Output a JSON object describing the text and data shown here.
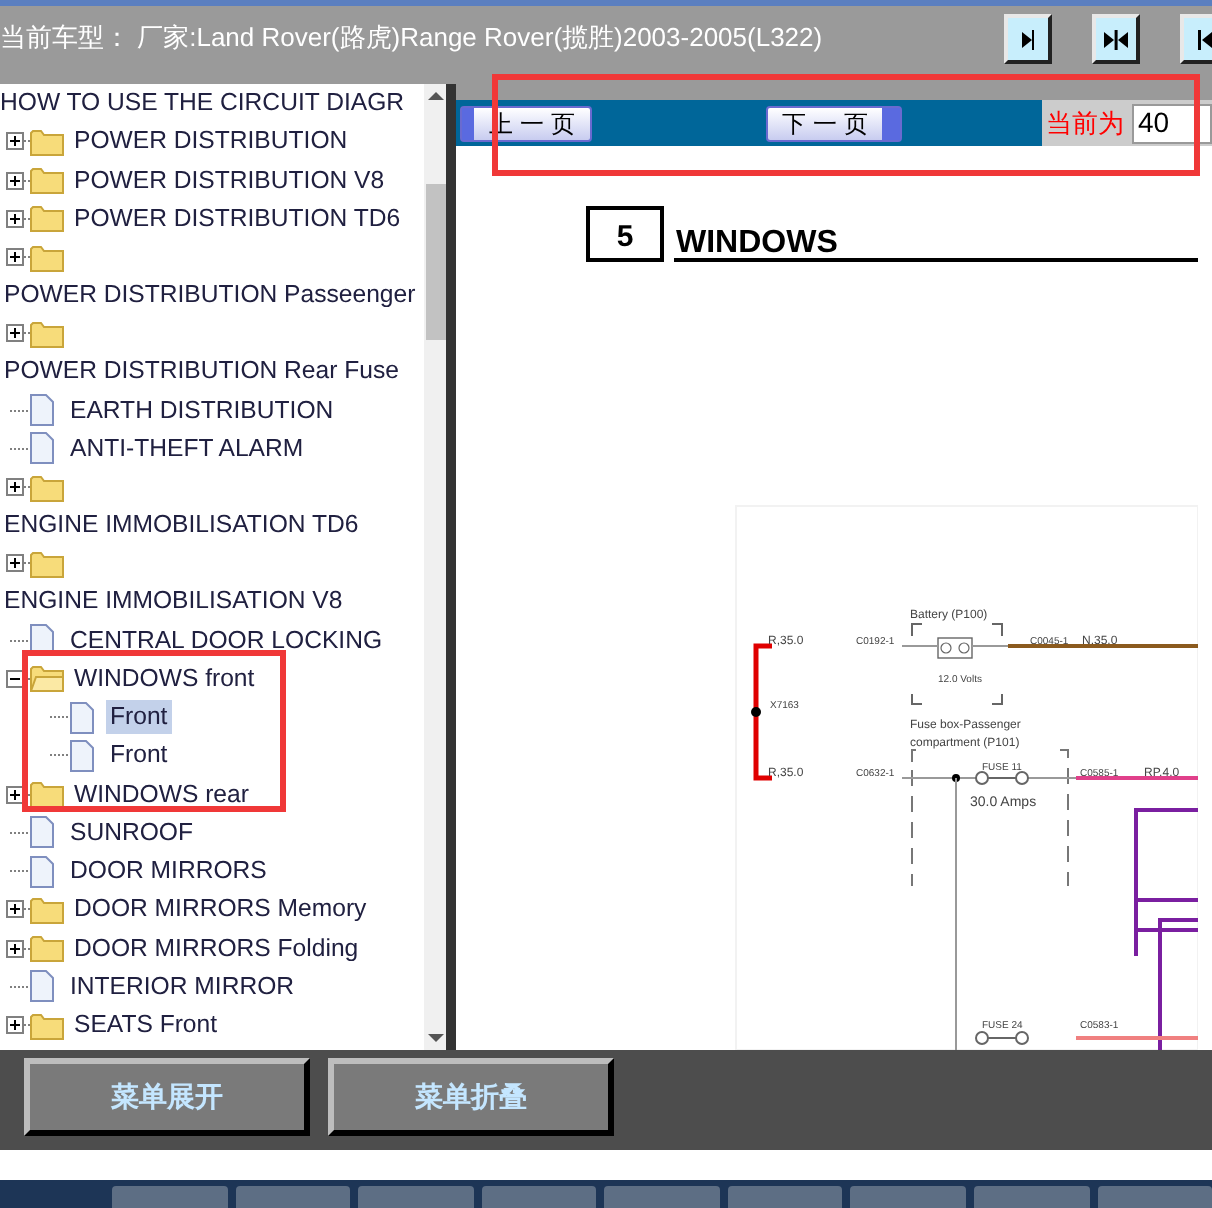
{
  "header": {
    "title": "当前车型：  厂家:Land Rover(路虎)Range Rover(揽胜)2003-2005(L322)",
    "buttons": [
      {
        "kind": "right"
      },
      {
        "kind": "both"
      },
      {
        "kind": "left"
      }
    ]
  },
  "tree": [
    {
      "kind": "fragment",
      "label": "HOW TO USE THE CIRCUIT DIAGR"
    },
    {
      "kind": "folder",
      "label": "POWER DISTRIBUTION",
      "expanded": false,
      "selected": false
    },
    {
      "kind": "folder",
      "label": "POWER DISTRIBUTION V8",
      "expanded": false,
      "selected": false
    },
    {
      "kind": "folder",
      "label": "POWER DISTRIBUTION TD6",
      "expanded": false,
      "selected": false
    },
    {
      "kind": "folder",
      "label": "POWER DISTRIBUTION Passeenger",
      "expanded": false,
      "selected": false
    },
    {
      "kind": "folder",
      "label": "POWER DISTRIBUTION Rear Fuse",
      "expanded": false,
      "selected": false
    },
    {
      "kind": "doc",
      "label": "EARTH DISTRIBUTION",
      "selected": false
    },
    {
      "kind": "doc",
      "label": "ANTI-THEFT ALARM",
      "selected": false
    },
    {
      "kind": "folder",
      "label": "ENGINE IMMOBILISATION TD6",
      "expanded": false,
      "selected": false
    },
    {
      "kind": "folder",
      "label": "ENGINE IMMOBILISATION V8",
      "expanded": false,
      "selected": false
    },
    {
      "kind": "doc",
      "label": "CENTRAL DOOR LOCKING",
      "selected": false
    },
    {
      "kind": "folder",
      "label": "WINDOWS front",
      "expanded": true,
      "selected": false,
      "children": [
        {
          "kind": "doc",
          "label": "Front",
          "selected": true
        },
        {
          "kind": "doc",
          "label": "Front",
          "selected": false
        }
      ]
    },
    {
      "kind": "folder",
      "label": "WINDOWS rear",
      "expanded": false,
      "selected": false
    },
    {
      "kind": "doc",
      "label": "SUNROOF",
      "selected": false
    },
    {
      "kind": "doc",
      "label": "DOOR MIRRORS",
      "selected": false
    },
    {
      "kind": "folder",
      "label": "DOOR MIRRORS Memory",
      "expanded": false,
      "selected": false
    },
    {
      "kind": "folder",
      "label": "DOOR MIRRORS Folding",
      "expanded": false,
      "selected": false
    },
    {
      "kind": "doc",
      "label": "INTERIOR MIRROR",
      "selected": false
    },
    {
      "kind": "folder",
      "label": "SEATS Front",
      "expanded": false,
      "selected": false
    }
  ],
  "pager": {
    "prev": "上 一 页",
    "next": "下 一 页",
    "current_label": "当前为",
    "current_value": "40"
  },
  "document": {
    "section_number": "5",
    "section_title": "WINDOWS",
    "labels": {
      "battery": "Battery (P100)",
      "wire_top_left": "R,35.0",
      "conn_top_left": "C0192-1",
      "conn_top_right": "C0045-1",
      "wire_top_right": "N,35.0",
      "volts": "12.0 Volts",
      "splice": "X7163",
      "fusebox_line1": "Fuse box-Passenger",
      "fusebox_line2": "compartment (P101)",
      "wire_bottom_left": "R,35.0",
      "conn_bottom_left": "C0632-1",
      "fuse_a": "FUSE 11",
      "amps_a": "30.0 Amps",
      "conn_bottom_right": "C0585-1",
      "wire_bottom_right": "RP,4.0",
      "fuse_b": "FUSE 24",
      "conn_low": "C0583-1"
    }
  },
  "footer": {
    "buttons": [
      "菜单展开",
      "菜单折叠"
    ]
  }
}
